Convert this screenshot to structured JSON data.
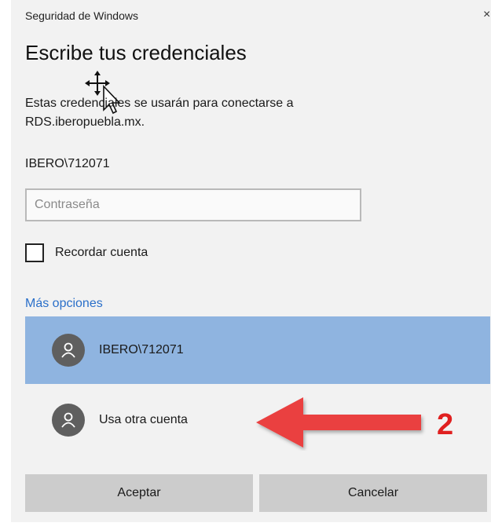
{
  "window": {
    "title": "Seguridad de Windows",
    "close_glyph": "×"
  },
  "dialog": {
    "heading": "Escribe tus credenciales",
    "description_line1": "Estas credenciales se usarán para conectarse a",
    "description_line2": "RDS.iberopuebla.mx.",
    "username": "IBERO\\712071"
  },
  "password": {
    "placeholder": "Contraseña",
    "value": ""
  },
  "remember": {
    "label": "Recordar cuenta",
    "checked": false
  },
  "more_options": {
    "label": "Más opciones"
  },
  "accounts": [
    {
      "label": "IBERO\\712071",
      "selected": true,
      "icon": "user-avatar-icon"
    },
    {
      "label": "Usa otra cuenta",
      "selected": false,
      "icon": "user-avatar-icon"
    }
  ],
  "annotation": {
    "number": "2",
    "color": "#e02020"
  },
  "buttons": {
    "ok": "Aceptar",
    "cancel": "Cancelar"
  },
  "colors": {
    "selected_bg": "#8fb4e0",
    "link": "#2a6fc9",
    "button_bg": "#cccccc"
  }
}
